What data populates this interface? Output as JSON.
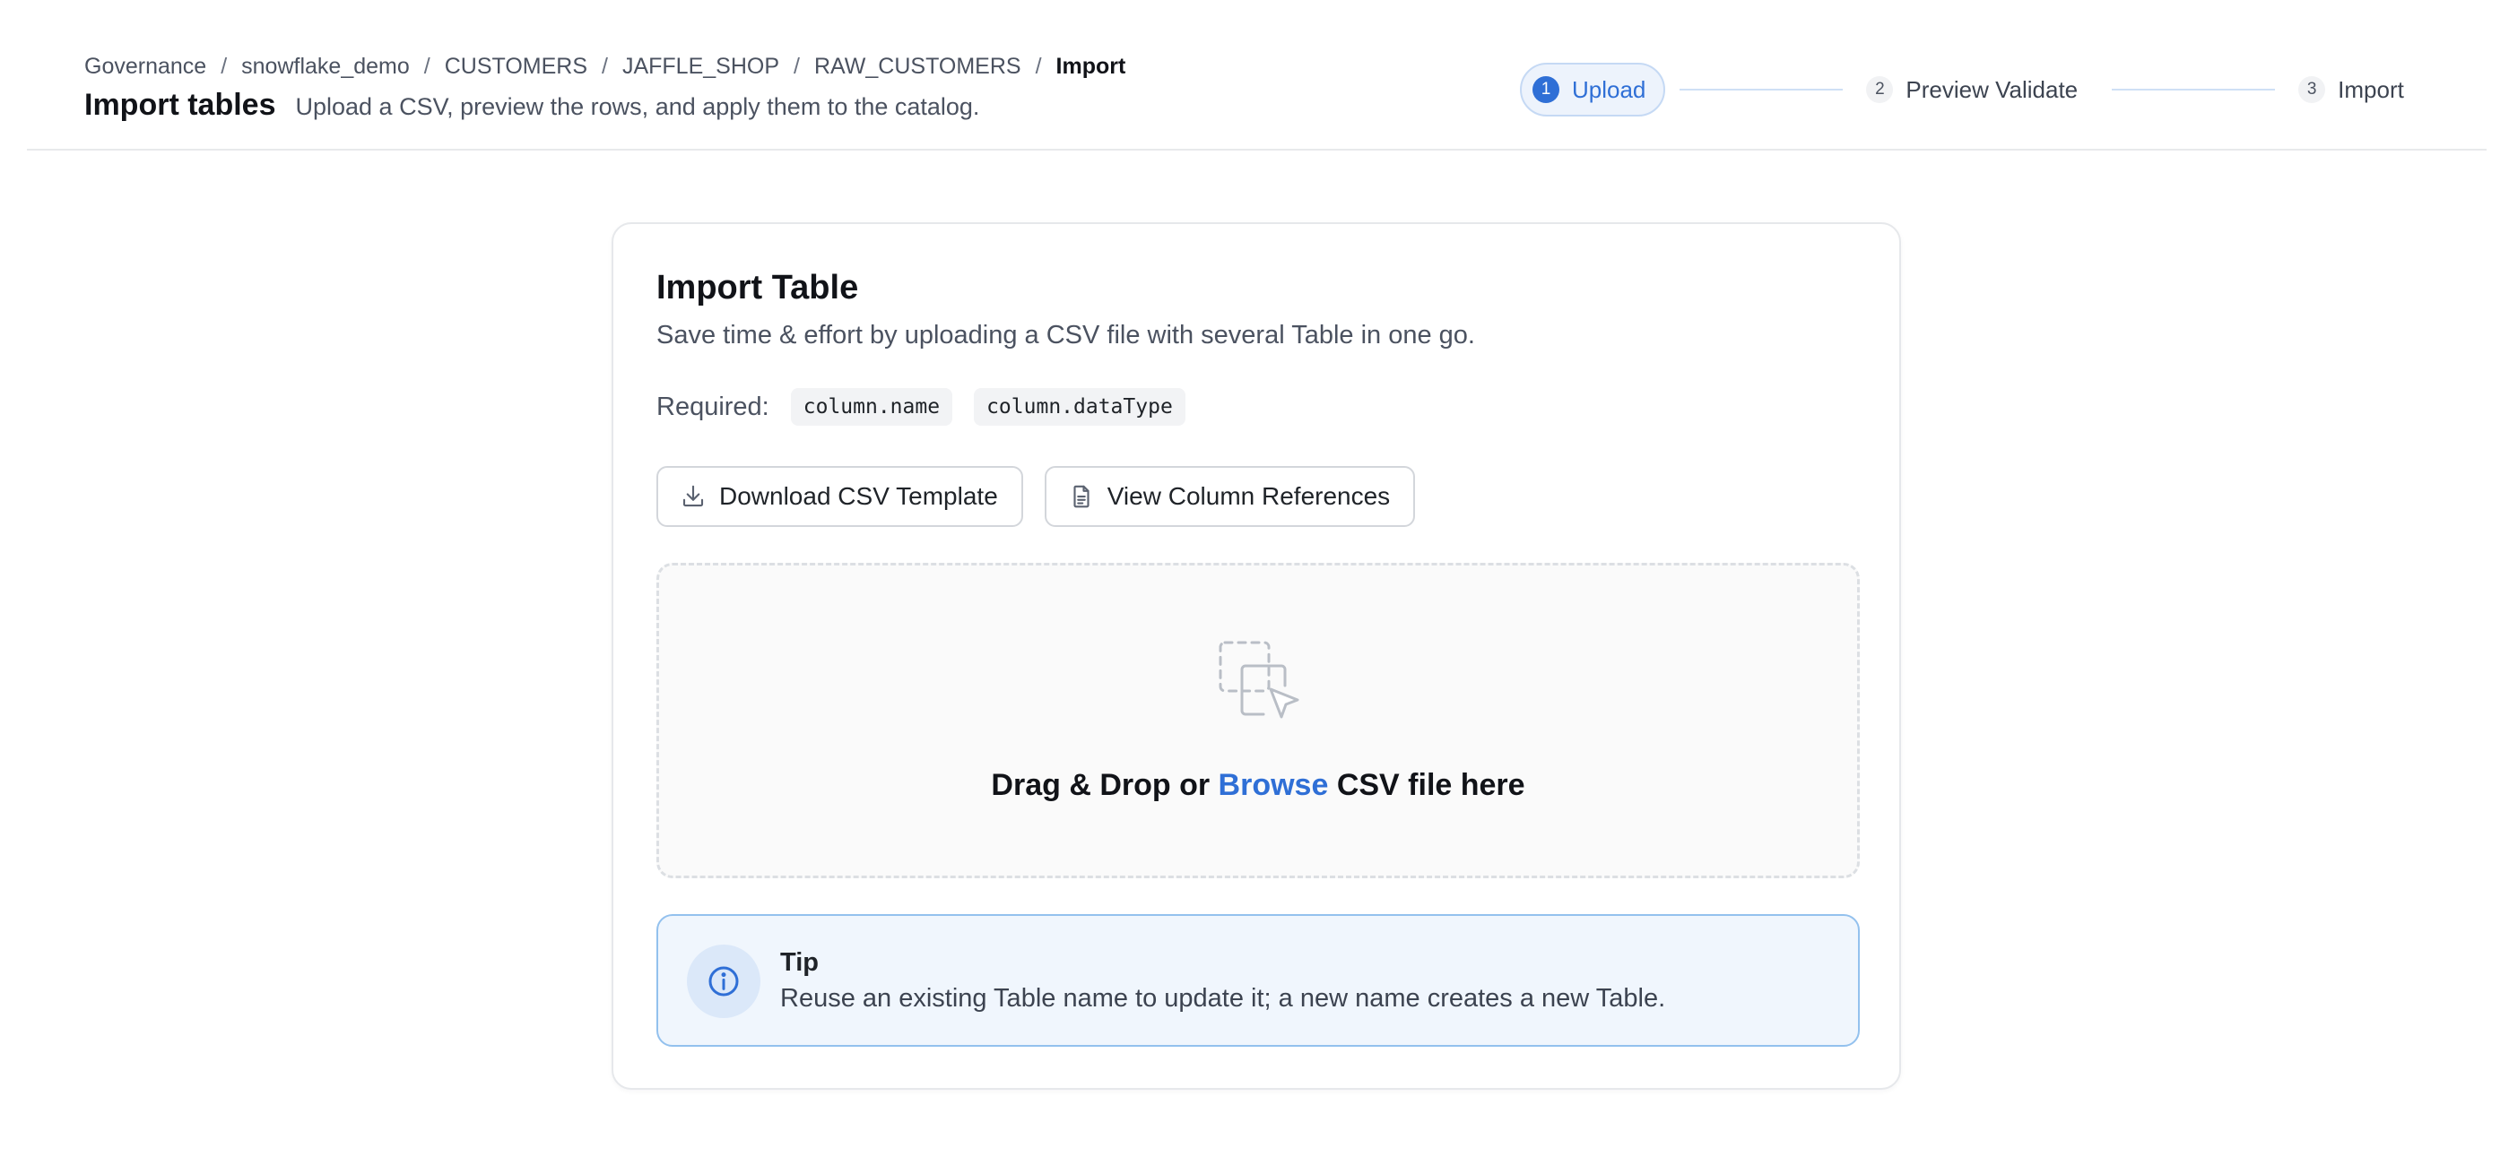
{
  "breadcrumb": {
    "items": [
      "Governance",
      "snowflake_demo",
      "CUSTOMERS",
      "JAFFLE_SHOP",
      "RAW_CUSTOMERS"
    ],
    "current": "Import",
    "separator": "/"
  },
  "header": {
    "title": "Import tables",
    "subtitle": "Upload a CSV, preview the rows, and apply them to the catalog."
  },
  "stepper": {
    "steps": [
      {
        "number": "1",
        "label": "Upload",
        "active": true
      },
      {
        "number": "2",
        "label": "Preview Validate",
        "active": false
      },
      {
        "number": "3",
        "label": "Import",
        "active": false
      }
    ]
  },
  "card": {
    "title": "Import Table",
    "description": "Save time & effort by uploading a CSV file with several Table in one go.",
    "required_label": "Required:",
    "required_fields": [
      "column.name",
      "column.dataType"
    ],
    "buttons": {
      "download_template": "Download CSV Template",
      "view_references": "View Column References"
    },
    "dropzone": {
      "text_before": "Drag & Drop or",
      "browse": "Browse",
      "text_after": "CSV file here"
    },
    "tip": {
      "title": "Tip",
      "text": "Reuse an existing Table name to update it; a new name creates a new Table."
    }
  },
  "colors": {
    "accent": "#2f6fd6",
    "tip_border": "#93c1ee",
    "tip_background": "#f0f6fd"
  },
  "icons": {
    "download": "download-icon",
    "document": "document-icon",
    "drop": "drag-drop-icon",
    "info": "info-icon"
  }
}
